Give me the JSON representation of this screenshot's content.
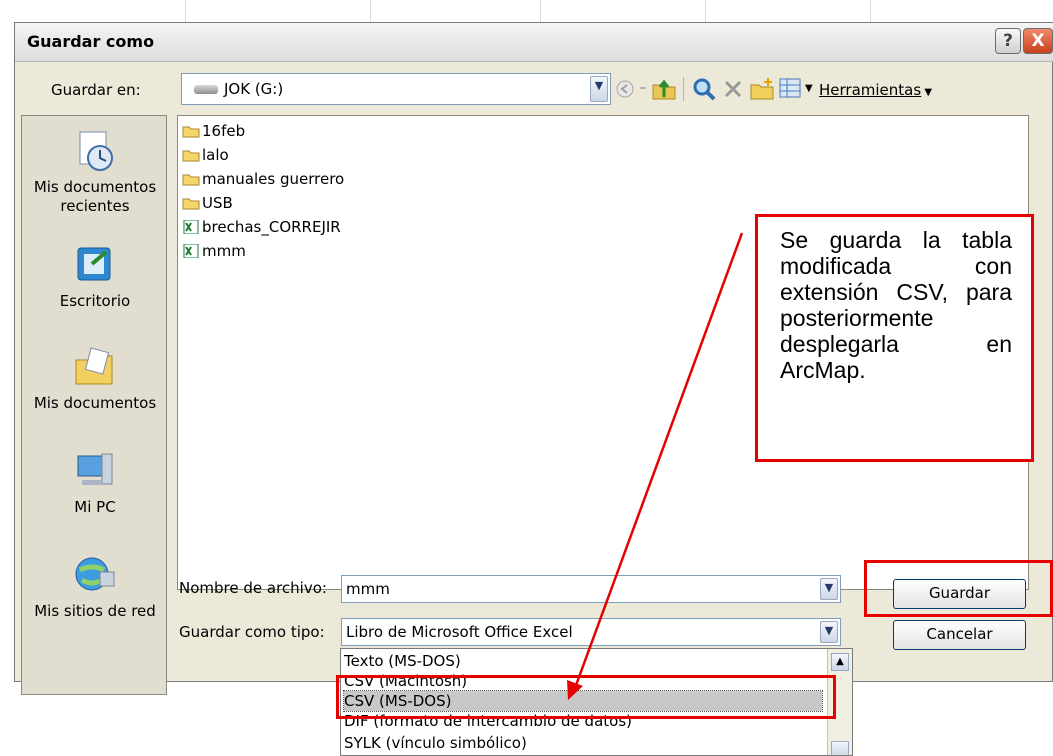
{
  "dialog": {
    "title": "Guardar como",
    "help_label": "?",
    "close_label": "X"
  },
  "toolbar": {
    "save_in_label": "Guardar en:",
    "save_in_value": "JOK (G:)",
    "tools_label": "Herramientas"
  },
  "places": [
    {
      "label": "Mis documentos recientes",
      "icon": "recent-documents-icon"
    },
    {
      "label": "Escritorio",
      "icon": "desktop-icon"
    },
    {
      "label": "Mis documentos",
      "icon": "my-documents-icon"
    },
    {
      "label": "Mi PC",
      "icon": "my-computer-icon"
    },
    {
      "label": "Mis sitios de red",
      "icon": "network-places-icon"
    }
  ],
  "files": [
    {
      "name": "16feb",
      "type": "folder"
    },
    {
      "name": "lalo",
      "type": "folder"
    },
    {
      "name": "manuales guerrero",
      "type": "folder"
    },
    {
      "name": "USB",
      "type": "folder"
    },
    {
      "name": "brechas_CORREJIR",
      "type": "excel"
    },
    {
      "name": "mmm",
      "type": "excel"
    }
  ],
  "form": {
    "filename_label": "Nombre de archivo:",
    "filename_value": "mmm",
    "type_label": "Guardar como tipo:",
    "type_value": "Libro de Microsoft Office Excel"
  },
  "buttons": {
    "save": "Guardar",
    "cancel": "Cancelar"
  },
  "type_options": [
    "Texto (MS-DOS)",
    "CSV (Macintosh)",
    "CSV (MS-DOS)",
    "DIF (formato de intercambio de datos)",
    "SYLK (vínculo simbólico)"
  ],
  "selected_option": "CSV (MS-DOS)",
  "annotation": {
    "text": "Se guarda la tabla modificada con extensión CSV, para posteriormente desplegarla en ArcMap."
  },
  "colors": {
    "annotation_red": "#e60000",
    "dialog_bg": "#ece9d8",
    "folder_yellow": "#f5d66b",
    "excel_green": "#1e7b34"
  }
}
